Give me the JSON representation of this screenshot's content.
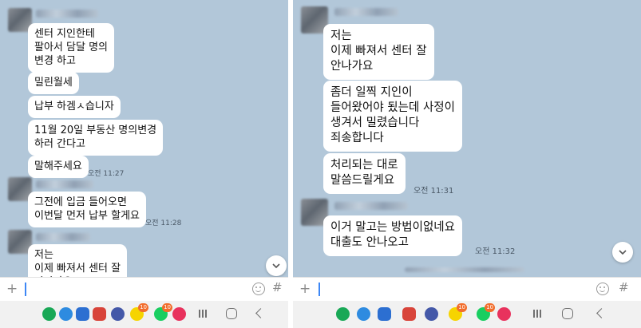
{
  "left_panel": {
    "messages": [
      {
        "text": "센터 지인한테\n팔아서 담달 명의\n변경 하고"
      },
      {
        "text": "밀린월세"
      },
      {
        "text": "납부 하겜ㅅ습니자"
      },
      {
        "text": "11월 20일 부동산 명의변경\n하러 간다고"
      },
      {
        "text": "말해주세요",
        "time": "오전 11:27"
      },
      {
        "text": "그전에 입금 들어오면\n이번달 먼저 납부 할게요",
        "time": "오전 11:28"
      },
      {
        "text": "저는\n이제 빠져서 센터 잘\n안나가요"
      }
    ],
    "input": {
      "placeholder": ""
    }
  },
  "right_panel": {
    "messages": [
      {
        "text": "저는\n이제 빠져서 센터 잘\n안나가요"
      },
      {
        "text": "좀더 일찍 지인이\n들어왔어야 됬는데 사정이\n생겨서 밀렸습니다\n죄송합니다"
      },
      {
        "text": "처리되는 대로\n말씀드릴게요",
        "time": "오전 11:31"
      },
      {
        "text": "이거 말고는 방법이없네요\n대출도 안나오고",
        "time": "오전 11:32"
      }
    ],
    "input": {
      "placeholder": ""
    }
  },
  "composer": {
    "plus": "+",
    "hash": "#"
  },
  "taskbar": {
    "apps": [
      {
        "icon": "c-app-icon",
        "color": "#19a856",
        "label": "C"
      },
      {
        "icon": "browser-icon",
        "color": "#2e8be0"
      },
      {
        "icon": "messages-icon",
        "color": "#2c6fd1"
      },
      {
        "icon": "mail-icon",
        "color": "#d8443a"
      },
      {
        "icon": "apps-grid-icon",
        "color": "#4458a8"
      },
      {
        "icon": "kakaotalk-icon",
        "color": "#f6d400",
        "badge": "10"
      },
      {
        "icon": "naver-icon",
        "color": "#19ce60",
        "label": "N",
        "badge": "10"
      },
      {
        "icon": "free-icon",
        "color": "#e8325d",
        "label": "FREE"
      }
    ]
  },
  "colors": {
    "chat_bg": "#b2c7d9",
    "bubble": "#ffffff",
    "cursor": "#3d87f5"
  }
}
